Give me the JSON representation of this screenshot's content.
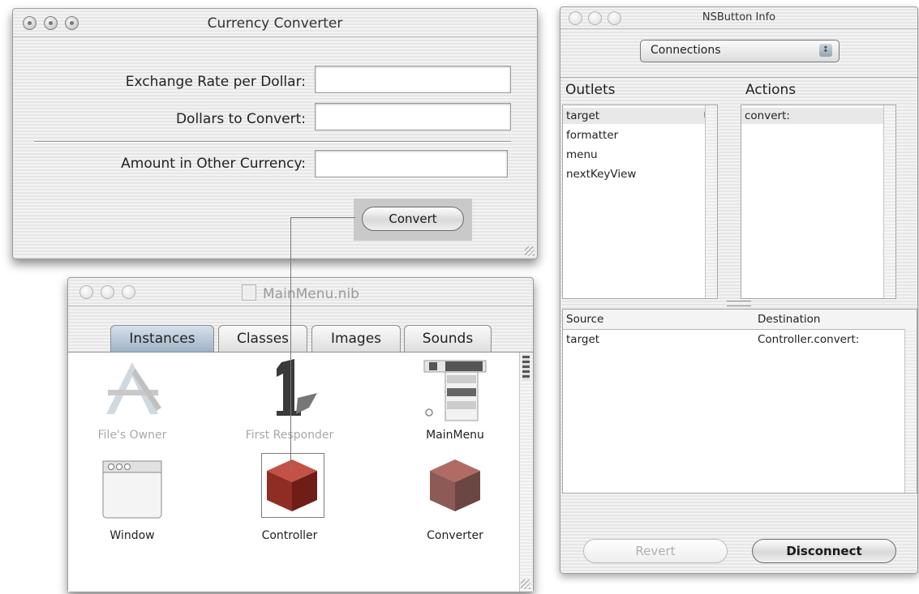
{
  "currency_window": {
    "title": "Currency Converter",
    "exchange_rate_label": "Exchange Rate per Dollar:",
    "exchange_rate_value": "",
    "dollars_label": "Dollars to Convert:",
    "dollars_value": "",
    "amount_label": "Amount in Other Currency:",
    "amount_value": "",
    "convert_label": "Convert"
  },
  "nib_window": {
    "title": "MainMenu.nib",
    "tabs": [
      {
        "label": "Instances",
        "active": true
      },
      {
        "label": "Classes",
        "active": false
      },
      {
        "label": "Images",
        "active": false
      },
      {
        "label": "Sounds",
        "active": false
      }
    ],
    "items": [
      {
        "name": "File's Owner",
        "icon": "app-icon",
        "dimmed": true
      },
      {
        "name": "First Responder",
        "icon": "first-responder-icon",
        "dimmed": true
      },
      {
        "name": "MainMenu",
        "icon": "menu-icon",
        "dimmed": false
      },
      {
        "name": "Window",
        "icon": "window-icon",
        "dimmed": false
      },
      {
        "name": "Controller",
        "icon": "cube-icon",
        "dimmed": false,
        "selected": true
      },
      {
        "name": "Converter",
        "icon": "cube-icon",
        "dimmed": false
      }
    ]
  },
  "info_window": {
    "title": "NSButton Info",
    "popup_value": "Connections",
    "outlets_header": "Outlets",
    "actions_header": "Actions",
    "outlets": [
      "target",
      "formatter",
      "menu",
      "nextKeyView"
    ],
    "actions": [
      "convert:"
    ],
    "source_header": "Source",
    "destination_header": "Destination",
    "connections": [
      {
        "source": "target",
        "destination": "Controller.convert:"
      }
    ],
    "revert_label": "Revert",
    "disconnect_label": "Disconnect"
  },
  "colors": {
    "tab_active": "#b3c4d6",
    "cube_red": "#a02a22",
    "cube_gray": "#8a8a8a",
    "selection_gray": "#c9c9c9"
  }
}
